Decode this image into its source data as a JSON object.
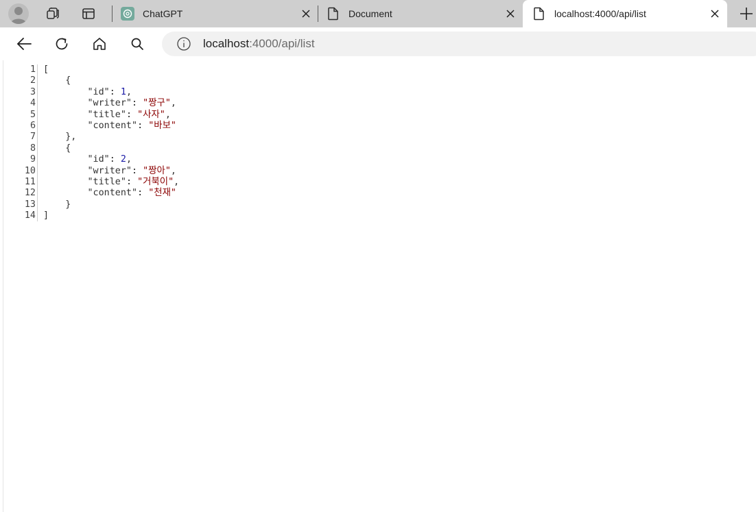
{
  "tabs": [
    {
      "label": "ChatGPT",
      "icon": "chatgpt-icon"
    },
    {
      "label": "Document",
      "icon": "document-icon"
    },
    {
      "label": "localhost:4000/api/list",
      "icon": "document-icon",
      "active": true
    }
  ],
  "address": {
    "host": "localhost",
    "rest": ":4000/api/list"
  },
  "json_lines": [
    {
      "n": "1",
      "t": "["
    },
    {
      "n": "2",
      "t": "    {"
    },
    {
      "n": "3",
      "t": "        \"id\": 1,"
    },
    {
      "n": "4",
      "t": "        \"writer\": \"짱구\","
    },
    {
      "n": "5",
      "t": "        \"title\": \"사자\","
    },
    {
      "n": "6",
      "t": "        \"content\": \"바보\""
    },
    {
      "n": "7",
      "t": "    },"
    },
    {
      "n": "8",
      "t": "    {"
    },
    {
      "n": "9",
      "t": "        \"id\": 2,"
    },
    {
      "n": "10",
      "t": "        \"writer\": \"짱아\","
    },
    {
      "n": "11",
      "t": "        \"title\": \"거북이\","
    },
    {
      "n": "12",
      "t": "        \"content\": \"천재\""
    },
    {
      "n": "13",
      "t": "    }"
    },
    {
      "n": "14",
      "t": "]"
    }
  ],
  "colors": {
    "tabstrip": "#cfcfcf",
    "string": "#8b0000",
    "number": "#1a1aa6"
  }
}
